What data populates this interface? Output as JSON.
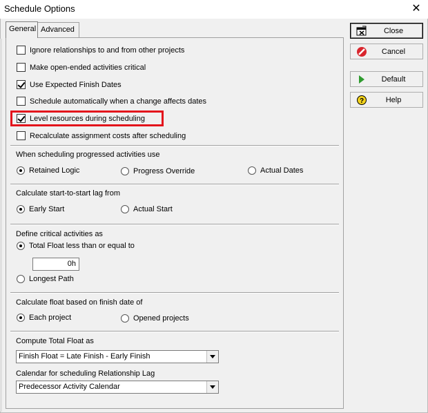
{
  "window": {
    "title": "Schedule Options",
    "close_glyph": "✕"
  },
  "tabs": [
    {
      "label": "General",
      "active": true
    },
    {
      "label": "Advanced",
      "active": false
    }
  ],
  "checkboxes": [
    {
      "label": "Ignore relationships to and from other projects",
      "checked": false
    },
    {
      "label": "Make open-ended activities critical",
      "checked": false
    },
    {
      "label": "Use Expected Finish Dates",
      "checked": true
    },
    {
      "label": "Schedule automatically when a change affects dates",
      "checked": false
    },
    {
      "label": "Level resources during scheduling",
      "checked": true,
      "highlighted": true
    },
    {
      "label": "Recalculate assignment costs after scheduling",
      "checked": false
    }
  ],
  "progressed": {
    "heading": "When scheduling progressed activities use",
    "options": [
      {
        "label": "Retained Logic",
        "selected": true
      },
      {
        "label": "Progress Override",
        "selected": false
      },
      {
        "label": "Actual Dates",
        "selected": false
      }
    ]
  },
  "lag": {
    "heading": "Calculate start-to-start lag from",
    "options": [
      {
        "label": "Early Start",
        "selected": true
      },
      {
        "label": "Actual Start",
        "selected": false
      }
    ]
  },
  "critical": {
    "heading": "Define critical activities as",
    "options": [
      {
        "label": "Total Float less than or equal to",
        "selected": true
      },
      {
        "label": "Longest Path",
        "selected": false
      }
    ],
    "float_value": "0h"
  },
  "float_basis": {
    "heading": "Calculate float based on finish date of",
    "options": [
      {
        "label": "Each project",
        "selected": true
      },
      {
        "label": "Opened projects",
        "selected": false
      }
    ]
  },
  "total_float": {
    "heading": "Compute Total Float as",
    "selected": "Finish Float = Late Finish - Early Finish"
  },
  "calendar": {
    "heading": "Calendar for scheduling Relationship Lag",
    "selected": "Predecessor Activity Calendar"
  },
  "buttons": {
    "close": "Close",
    "cancel": "Cancel",
    "default": "Default",
    "help": "Help"
  },
  "colors": {
    "highlight": "#e3121b",
    "cancel_icon": "#d9262e",
    "default_icon": "#2e9b2e",
    "help_icon": "#f2d21c"
  }
}
